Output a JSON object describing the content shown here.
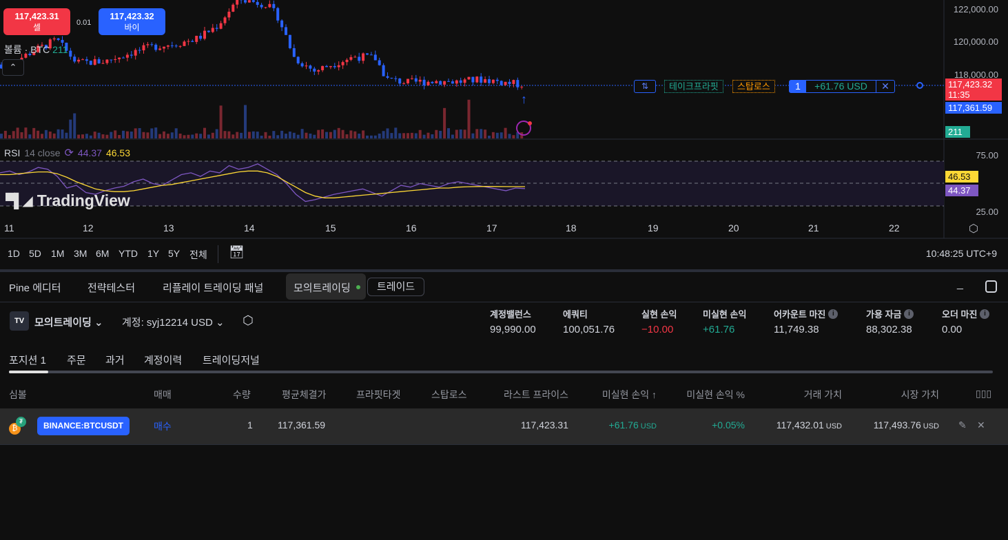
{
  "colors": {
    "up": "#f23645",
    "down": "#2962ff",
    "green": "#22ab94",
    "rsi": "#7e57c2",
    "rsi_ma": "#fdd835",
    "accent_blue": "#2962ff"
  },
  "trade_buttons": {
    "sell_price": "117,423.31",
    "sell_label": "셀",
    "spread": "0.01",
    "buy_price": "117,423.32",
    "buy_label": "바이"
  },
  "volume_legend": {
    "label": "볼륨 · BTC",
    "value": "211"
  },
  "price_axis": [
    "122,000.00",
    "120,000.00",
    "118,000.00"
  ],
  "position_line": {
    "label_tp": "테이크프라핏",
    "label_sl": "스탑로스",
    "qty": "1",
    "pnl": "+61.76 USD"
  },
  "price_tags": {
    "last": "117,423.32",
    "countdown": "11:35",
    "entry": "117,361.59",
    "volume": "211"
  },
  "price_path": [
    [
      11.0,
      118600
    ],
    [
      11.3,
      119400
    ],
    [
      11.6,
      120100
    ],
    [
      11.85,
      118700
    ],
    [
      12.2,
      118800
    ],
    [
      12.5,
      119300
    ],
    [
      12.8,
      119700
    ],
    [
      13.1,
      119900
    ],
    [
      13.35,
      120200
    ],
    [
      13.6,
      121000
    ],
    [
      13.85,
      122600
    ],
    [
      14.2,
      122300
    ],
    [
      14.35,
      121500
    ],
    [
      14.55,
      119000
    ],
    [
      14.8,
      118200
    ],
    [
      15.0,
      118600
    ],
    [
      15.3,
      119100
    ],
    [
      15.55,
      119000
    ],
    [
      15.7,
      117700
    ],
    [
      15.95,
      117500
    ],
    [
      16.3,
      117600
    ],
    [
      16.6,
      117550
    ],
    [
      16.9,
      117700
    ],
    [
      17.3,
      117400
    ],
    [
      17.41,
      117423
    ]
  ],
  "rsi": {
    "label": "RSI",
    "params": "14 close",
    "value": "44.37",
    "ma_value": "46.53",
    "axis": [
      "75.00",
      "25.00"
    ],
    "series": [
      62,
      64,
      60,
      63,
      68,
      66,
      58,
      45,
      48,
      40,
      38,
      42,
      45,
      47,
      52,
      55,
      50,
      48,
      54,
      60,
      62,
      58,
      64,
      62,
      70,
      66,
      68,
      72,
      66,
      60,
      50,
      38,
      30,
      32,
      35,
      38,
      40,
      42,
      44,
      40,
      36,
      42,
      48,
      46,
      50,
      48,
      46,
      50,
      52,
      50,
      48,
      46,
      44,
      42,
      45,
      44.37
    ],
    "ma": [
      60,
      60,
      61,
      62,
      63,
      63,
      61,
      57,
      52,
      48,
      44,
      42,
      41,
      41,
      42,
      44,
      46,
      48,
      49,
      51,
      53,
      55,
      57,
      59,
      61,
      63,
      64,
      64,
      62,
      58,
      52,
      46,
      40,
      36,
      34,
      34,
      35,
      36,
      37,
      38,
      39,
      40,
      41,
      42,
      43,
      44,
      45,
      45,
      46,
      46.5,
      46.7,
      46.8,
      46.7,
      46.6,
      46.55,
      46.53
    ]
  },
  "watermark": "TradingView",
  "date_axis": [
    "11",
    "12",
    "13",
    "14",
    "15",
    "16",
    "17",
    "18",
    "19",
    "20",
    "21",
    "22"
  ],
  "ranges": [
    "1D",
    "5D",
    "1M",
    "3M",
    "6M",
    "YTD",
    "1Y",
    "5Y",
    "전체"
  ],
  "clock": "10:48:25 UTC+9",
  "panel_tabs": [
    "Pine 에디터",
    "전략테스터",
    "리플레이 트레이딩 패널",
    "모의트레이딩",
    "트레이드"
  ],
  "broker": {
    "name": "모의트레이딩",
    "account": "계정: syj12214 USD"
  },
  "stats": [
    {
      "label": "계정밸런스",
      "value": "99,990.00"
    },
    {
      "label": "에쿼티",
      "value": "100,051.76"
    },
    {
      "label": "실현 손익",
      "value": "−10.00"
    },
    {
      "label": "미실현 손익",
      "value": "+61.76"
    },
    {
      "label": "어카운트 마진",
      "value": "11,749.38"
    },
    {
      "label": "가용 자금",
      "value": "88,302.38"
    },
    {
      "label": "오더 마진",
      "value": "0.00"
    }
  ],
  "sub_tabs": [
    "포지션 1",
    "주문",
    "과거",
    "계정이력",
    "트레이딩저널"
  ],
  "columns": [
    "심볼",
    "매매",
    "수량",
    "평균체결가",
    "프라핏타겟",
    "스탑로스",
    "라스트 프라이스",
    "미실현 손익 ↑",
    "미실현 손익 %",
    "거래 가치",
    "시장 가치"
  ],
  "positions": [
    {
      "symbol": "BINANCE:BTCUSDT",
      "side": "매수",
      "qty": "1",
      "avg": "117,361.59",
      "last": "117,423.31",
      "pnl": "+61.76",
      "pnl_pct": "+0.05%",
      "trade_value": "117,432.01",
      "market_value": "117,493.76",
      "currency": "USD"
    }
  ]
}
